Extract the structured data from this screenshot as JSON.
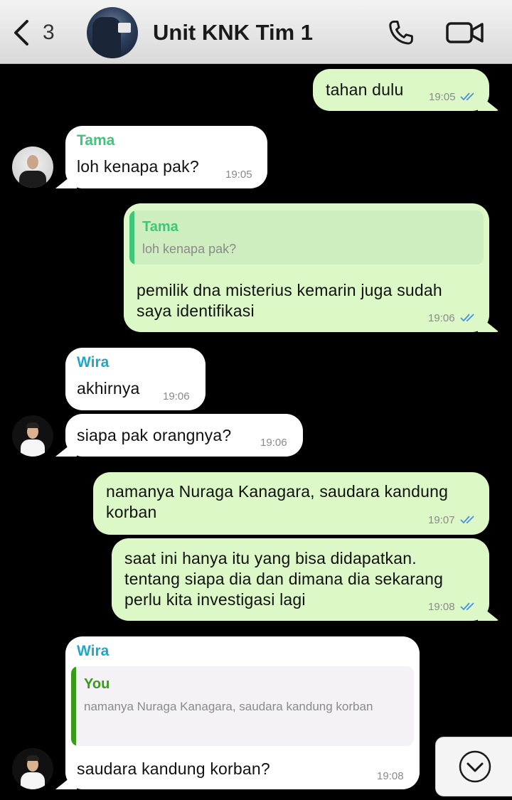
{
  "header": {
    "back_count": "3",
    "title": "Unit KNK Tim 1"
  },
  "colors": {
    "outgoing_bubble": "#dcf8c6",
    "incoming_bubble": "#ffffff",
    "tama_name": "#3ec77a",
    "wira_name": "#1fa8c9",
    "you_name": "#3a9a1a",
    "read_ticks": "#4a8fe0"
  },
  "messages": [
    {
      "from": "me",
      "text": "tahan dulu",
      "time": "19:05",
      "status": "read"
    },
    {
      "from": "Tama",
      "sender": "Tama",
      "text": "loh kenapa pak?",
      "time": "19:05"
    },
    {
      "from": "me",
      "quote": {
        "name": "Tama",
        "text": "loh kenapa pak?"
      },
      "text_lines": [
        "pemilik dna misterius kemarin juga sudah",
        "saya identifikasi"
      ],
      "time": "19:06",
      "status": "read"
    },
    {
      "from": "Wira",
      "sender": "Wira",
      "text": "akhirnya",
      "time": "19:06"
    },
    {
      "from": "Wira",
      "text": "siapa pak orangnya?",
      "time": "19:06"
    },
    {
      "from": "me",
      "text_lines": [
        "namanya Nuraga Kanagara, saudara kandung",
        "korban"
      ],
      "time": "19:07",
      "status": "read"
    },
    {
      "from": "me",
      "text_lines": [
        "saat ini hanya itu yang bisa didapatkan.",
        "tentang siapa dia dan dimana dia sekarang",
        "perlu kita investigasi lagi"
      ],
      "time": "19:08",
      "status": "read"
    },
    {
      "from": "Wira",
      "sender": "Wira",
      "quote": {
        "name": "You",
        "text": "namanya Nuraga Kanagara, saudara kandung korban"
      },
      "text": "saudara kandung korban?",
      "time": "19:08"
    }
  ],
  "icons": {
    "back": "chevron-left-icon",
    "call": "phone-icon",
    "video": "video-camera-icon",
    "scroll_down": "chevron-down-circle-icon"
  }
}
